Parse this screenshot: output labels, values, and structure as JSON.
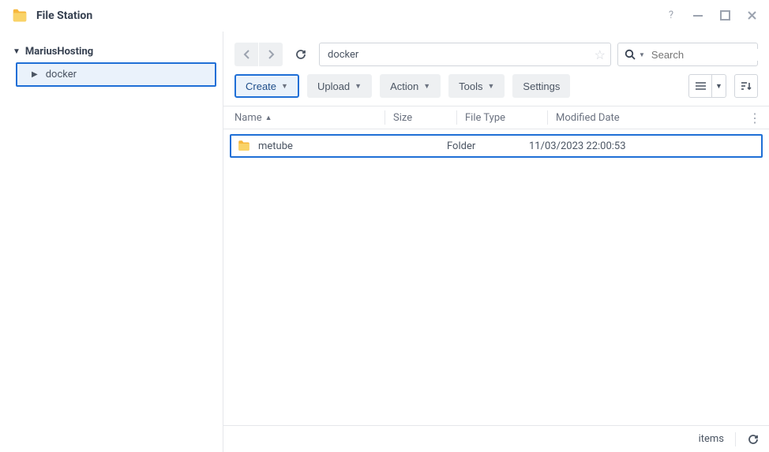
{
  "window": {
    "title": "File Station"
  },
  "sidebar": {
    "root": "MariusHosting",
    "items": [
      {
        "label": "docker"
      }
    ]
  },
  "toolbar": {
    "path": "docker",
    "search_placeholder": "Search",
    "buttons": {
      "create": "Create",
      "upload": "Upload",
      "action": "Action",
      "tools": "Tools",
      "settings": "Settings"
    }
  },
  "table": {
    "columns": {
      "name": "Name",
      "size": "Size",
      "type": "File Type",
      "modified": "Modified Date"
    },
    "rows": [
      {
        "name": "metube",
        "size": "",
        "type": "Folder",
        "modified": "11/03/2023 22:00:53"
      }
    ]
  },
  "status": {
    "label": "items"
  }
}
